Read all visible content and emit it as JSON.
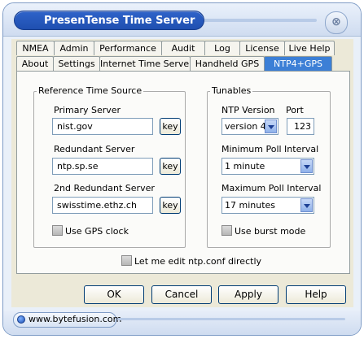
{
  "window": {
    "title": "PresenTense Time Server",
    "close_symbol": "⊗"
  },
  "tabs": {
    "row1": [
      "NMEA",
      "Admin",
      "Performance",
      "Audit",
      "Log",
      "License",
      "Live Help"
    ],
    "row2": [
      "About",
      "Settings",
      "Internet Time Server",
      "Handheld GPS",
      "NTP4+GPS"
    ],
    "active": "NTP4+GPS"
  },
  "reference": {
    "legend": "Reference Time Source",
    "primary_label": "Primary Server",
    "primary_value": "nist.gov",
    "redundant_label": "Redundant Server",
    "redundant_value": "ntp.sp.se",
    "second_label": "2nd Redundant Server",
    "second_value": "swisstime.ethz.ch",
    "key_label": "key",
    "gps_clock_label": "Use GPS clock"
  },
  "tunables": {
    "legend": "Tunables",
    "ntp_version_label": "NTP Version",
    "ntp_version_value": "version 4",
    "port_label": "Port",
    "port_value": "123",
    "min_poll_label": "Minimum Poll Interval",
    "min_poll_value": "1 minute",
    "max_poll_label": "Maximum Poll Interval",
    "max_poll_value": "17 minutes",
    "burst_label": "Use burst mode"
  },
  "edit_conf_label": "Let me edit ntp.conf directly",
  "buttons": {
    "ok": "OK",
    "cancel": "Cancel",
    "apply": "Apply",
    "help": "Help"
  },
  "status": {
    "url": "www.bytefusion.com"
  },
  "colors": {
    "title_pill": "#2456bd",
    "active_tab": "#3c7fd6",
    "window_bg": "#e9f0f9",
    "dialog_bg": "#ece9d8"
  }
}
